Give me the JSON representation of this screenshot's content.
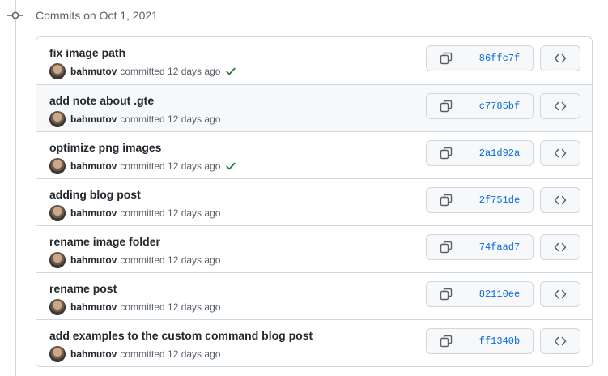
{
  "group": {
    "title": "Commits on Oct 1, 2021"
  },
  "commits": [
    {
      "title": "fix image path",
      "author": "bahmutov",
      "time": "committed 12 days ago",
      "verified": true,
      "sha": "86ffc7f"
    },
    {
      "title": "add note about .gte",
      "author": "bahmutov",
      "time": "committed 12 days ago",
      "verified": false,
      "sha": "c7785bf"
    },
    {
      "title": "optimize png images",
      "author": "bahmutov",
      "time": "committed 12 days ago",
      "verified": true,
      "sha": "2a1d92a"
    },
    {
      "title": "adding blog post",
      "author": "bahmutov",
      "time": "committed 12 days ago",
      "verified": false,
      "sha": "2f751de"
    },
    {
      "title": "rename image folder",
      "author": "bahmutov",
      "time": "committed 12 days ago",
      "verified": false,
      "sha": "74faad7"
    },
    {
      "title": "rename post",
      "author": "bahmutov",
      "time": "committed 12 days ago",
      "verified": false,
      "sha": "82110ee"
    },
    {
      "title": "add examples to the custom command blog post",
      "author": "bahmutov",
      "time": "committed 12 days ago",
      "verified": false,
      "sha": "ff1340b"
    }
  ],
  "icons": {
    "timeline": "git-commit-icon",
    "status": "check-icon",
    "copy": "copy-icon",
    "browse": "code-icon"
  },
  "colors": {
    "link": "#0969da",
    "success": "#1a7f37",
    "border": "#d0d7de",
    "highlight_row": "#f6f8fa"
  },
  "highlighted_row": 1
}
